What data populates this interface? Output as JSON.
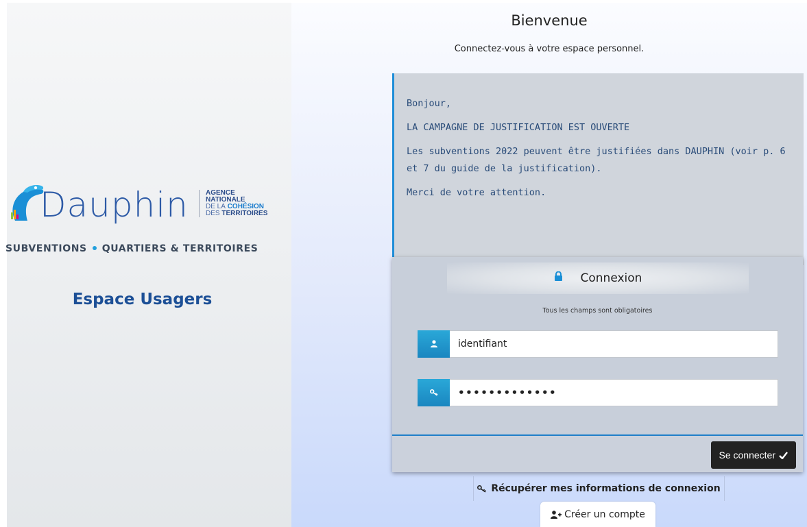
{
  "brand": {
    "wordmark": "Dauphin",
    "agency_line1": "AGENCE",
    "agency_line2": "NATIONALE",
    "agency_line3a": "DE LA",
    "agency_line3b": "COHÉSION",
    "agency_line4a": "DES",
    "agency_line4b": "TERRITOIRES",
    "tagline_left": "SUBVENTIONS",
    "tagline_right": "QUARTIERS & TERRITOIRES"
  },
  "left": {
    "espace_title": "Espace Usagers"
  },
  "header": {
    "title": "Bienvenue",
    "subtitle": "Connectez-vous à votre espace personnel."
  },
  "message": {
    "greeting": "Bonjour,",
    "headline": "LA CAMPAGNE DE JUSTIFICATION EST OUVERTE",
    "body": "Les subventions 2022 peuvent être justifiées dans DAUPHIN (voir p. 6 et 7 du guide de la justification).",
    "closing": "Merci de votre attention."
  },
  "login": {
    "title": "Connexion",
    "required_note": "Tous les champs sont obligatoires",
    "username_value": "identifiant",
    "password_value": "•••••••••••••",
    "submit_label": "Se connecter"
  },
  "links": {
    "recover": "Récupérer mes informations de connexion",
    "create_account": "Créer un compte"
  },
  "colors": {
    "accent": "#1f8ed8",
    "brand_blue": "#1c4f96",
    "button_dark": "#222222"
  }
}
